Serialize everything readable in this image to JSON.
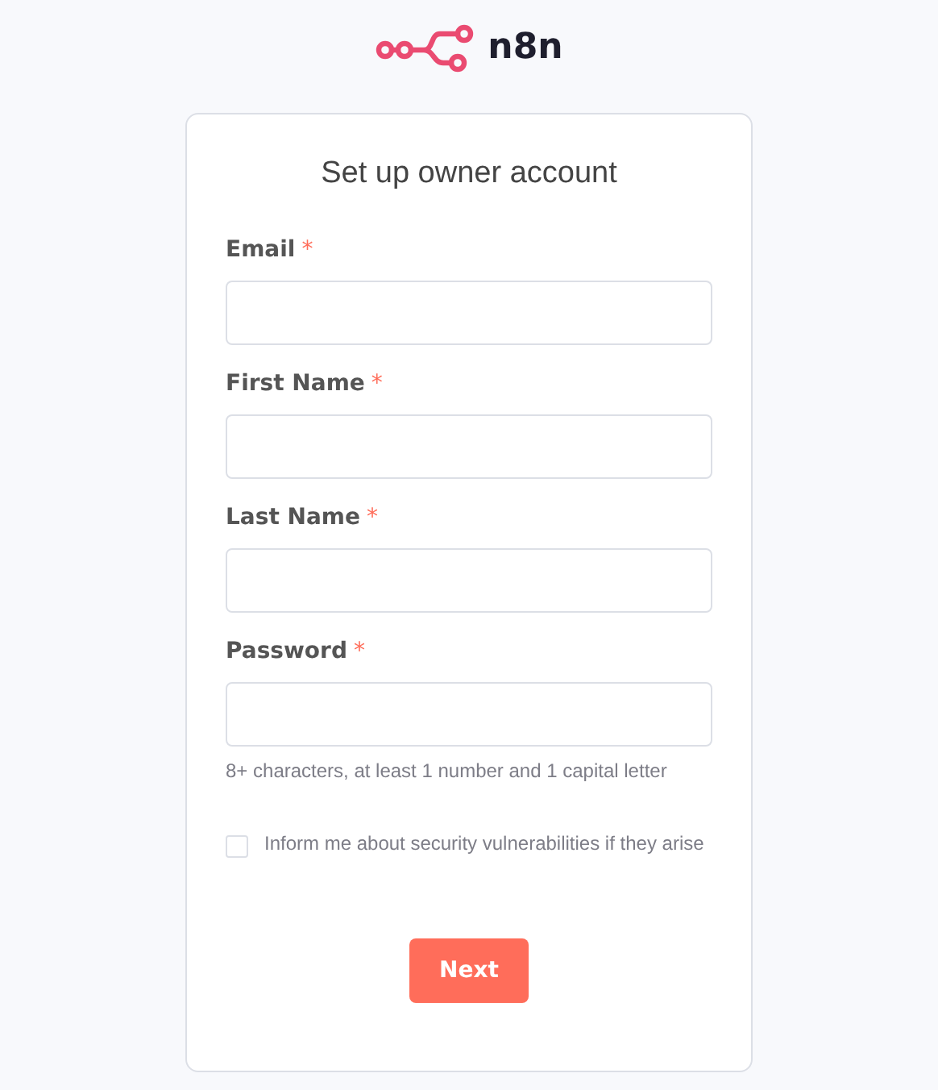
{
  "logo": {
    "text": "n8n"
  },
  "title": "Set up owner account",
  "fields": [
    {
      "label": "Email",
      "required": true
    },
    {
      "label": "First Name",
      "required": true
    },
    {
      "label": "Last Name",
      "required": true
    },
    {
      "label": "Password",
      "required": true,
      "hint": "8+ characters, at least 1 number and 1 capital letter"
    }
  ],
  "required_mark": "*",
  "checkbox": {
    "label": "Inform me about security vulnerabilities if they arise",
    "checked": false
  },
  "buttons": [
    "Next"
  ]
}
